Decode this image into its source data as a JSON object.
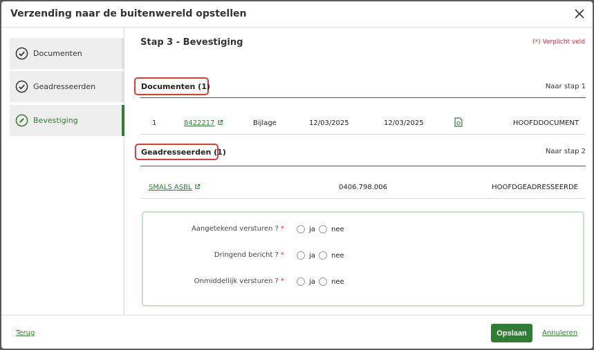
{
  "modal": {
    "title": "Verzending naar de buitenwereld opstellen"
  },
  "steps": [
    {
      "label": "Documenten",
      "icon": "check-circle-icon",
      "state": "done"
    },
    {
      "label": "Geadresseerden",
      "icon": "check-circle-icon",
      "state": "done"
    },
    {
      "label": "Bevestiging",
      "icon": "pencil-circle-icon",
      "state": "active"
    }
  ],
  "content": {
    "step_title": "Stap 3 - Bevestiging",
    "required_note": "(*) Verplicht veld",
    "documents": {
      "title": "Documenten (1)",
      "goto": "Naar stap 1",
      "rows": [
        {
          "index": "1",
          "number": "8422217",
          "type": "Bijlage",
          "date1": "12/03/2025",
          "date2": "12/03/2025",
          "role": "HOOFDDOCUMENT"
        }
      ]
    },
    "recipients": {
      "title": "Geadresseerden (1)",
      "goto": "Naar stap 2",
      "rows": [
        {
          "name": "SMALS ASBL",
          "number": "0406.798.006",
          "role": "HOOFDGEADRESSEERDE"
        }
      ]
    },
    "options": [
      {
        "question": "Aangetekend versturen ?",
        "star": "*",
        "yes": "ja",
        "no": "nee"
      },
      {
        "question": "Dringend bericht ?",
        "star": "*",
        "yes": "ja",
        "no": "nee"
      },
      {
        "question": "Onmiddellijk versturen ?",
        "star": "*",
        "yes": "ja",
        "no": "nee"
      }
    ]
  },
  "footer": {
    "back": "Terug",
    "save": "Opslaan",
    "cancel": "Annuleren"
  },
  "colors": {
    "accent": "#2e7d32",
    "required": "#d32f2f",
    "highlight": "#e53935"
  }
}
